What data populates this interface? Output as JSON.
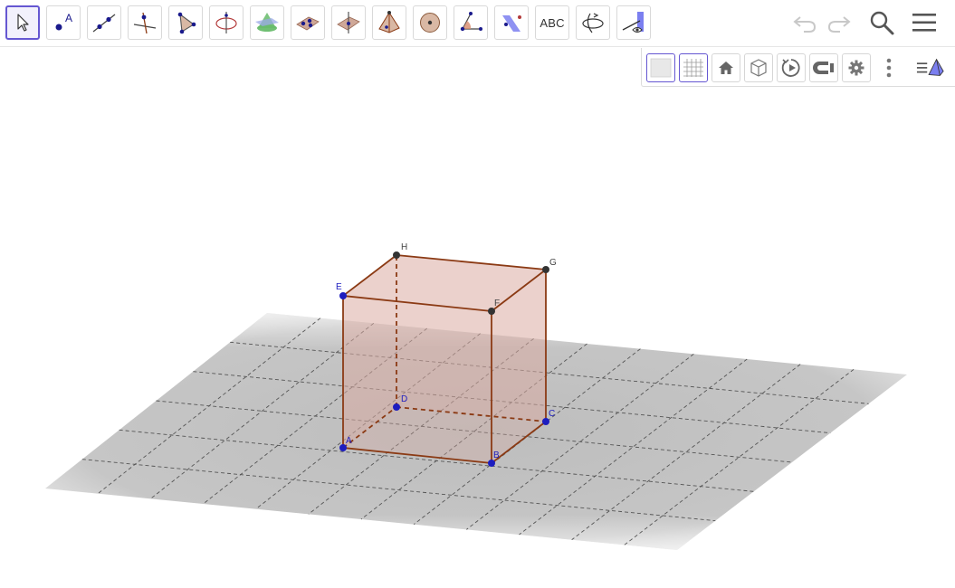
{
  "toolbar": {
    "tools": [
      {
        "name": "move-tool",
        "label": ""
      },
      {
        "name": "point-tool",
        "label": "A"
      },
      {
        "name": "line-tool",
        "label": ""
      },
      {
        "name": "perpendicular-line-tool",
        "label": ""
      },
      {
        "name": "polygon-tool",
        "label": ""
      },
      {
        "name": "circle-axis-tool",
        "label": ""
      },
      {
        "name": "intersect-surfaces-tool",
        "label": ""
      },
      {
        "name": "plane-three-points-tool",
        "label": ""
      },
      {
        "name": "perpendicular-plane-tool",
        "label": ""
      },
      {
        "name": "pyramid-tool",
        "label": ""
      },
      {
        "name": "sphere-tool",
        "label": ""
      },
      {
        "name": "angle-tool",
        "label": ""
      },
      {
        "name": "reflect-tool",
        "label": ""
      },
      {
        "name": "text-tool",
        "label": "ABC"
      },
      {
        "name": "rotate-view-tool",
        "label": ""
      },
      {
        "name": "view-from-front-tool",
        "label": ""
      }
    ],
    "selected_tool": "move-tool",
    "text_tool_label": "ABC",
    "point_tool_label": "A"
  },
  "style_bar": {
    "buttons": [
      "show-axes",
      "show-grid",
      "standard-view",
      "view-direction",
      "rotate-view",
      "clipping",
      "settings",
      "more",
      "graphics-view-toggle"
    ]
  },
  "scene": {
    "point_labels": {
      "A": "A",
      "B": "B",
      "C": "C",
      "D": "D",
      "E": "E",
      "F": "F",
      "G": "G",
      "H": "H"
    },
    "colors": {
      "edge": "#8b3a14",
      "face": "#d4a39a",
      "base_point": "#1d1dbf",
      "top_point": "#333333",
      "grid_line": "#555555",
      "accent": "#6557d2"
    }
  }
}
